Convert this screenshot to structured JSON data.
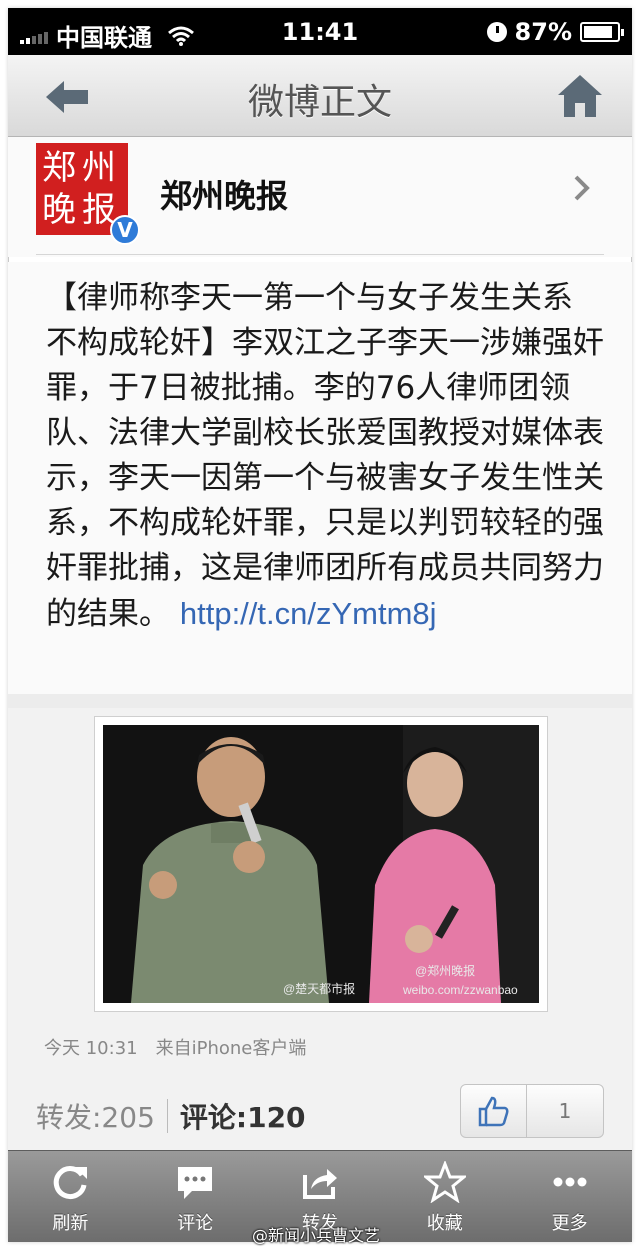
{
  "status_bar": {
    "carrier": "中国联通",
    "time": "11:41",
    "battery_text": "87%",
    "battery_level": 0.87
  },
  "nav": {
    "title": "微博正文",
    "back_icon": "back-arrow-icon",
    "home_icon": "home-icon"
  },
  "author": {
    "avatar_text": "郑州晚报",
    "verified_badge": "V",
    "name": "郑州晚报"
  },
  "post": {
    "text": "【律师称李天一第一个与女子发生关系 不构成轮奸】李双江之子李天一涉嫌强奸罪，于7日被批捕。李的76人律师团领队、法律大学副校长张爱国教授对媒体表示，李天一因第一个与被害女子发生性关系，不构成轮奸罪，只是以判罚较轻的强奸罪批捕，这是律师团所有成员共同努力的结果。",
    "link": "http://t.cn/zYmtm8j"
  },
  "photo": {
    "watermark_left": "@楚天都市报",
    "watermark_right_1": "@郑州晚报",
    "watermark_right_2": "weibo.com/zzwanbao"
  },
  "meta": {
    "time": "今天 10:31",
    "source": "来自iPhone客户端"
  },
  "counts": {
    "repost_label": "转发:205",
    "comment_label": "评论:120",
    "like_count": "1"
  },
  "tabbar": {
    "items": [
      {
        "label": "刷新",
        "icon": "refresh-icon"
      },
      {
        "label": "评论",
        "icon": "comment-icon"
      },
      {
        "label": "转发",
        "icon": "share-icon"
      },
      {
        "label": "收藏",
        "icon": "star-icon"
      },
      {
        "label": "更多",
        "icon": "more-icon"
      }
    ]
  },
  "footer_watermark": "@新闻小兵曹文艺",
  "colors": {
    "link": "#3567b4",
    "avatar_red": "#d11f1f",
    "verified_blue": "#2f7bd8"
  }
}
